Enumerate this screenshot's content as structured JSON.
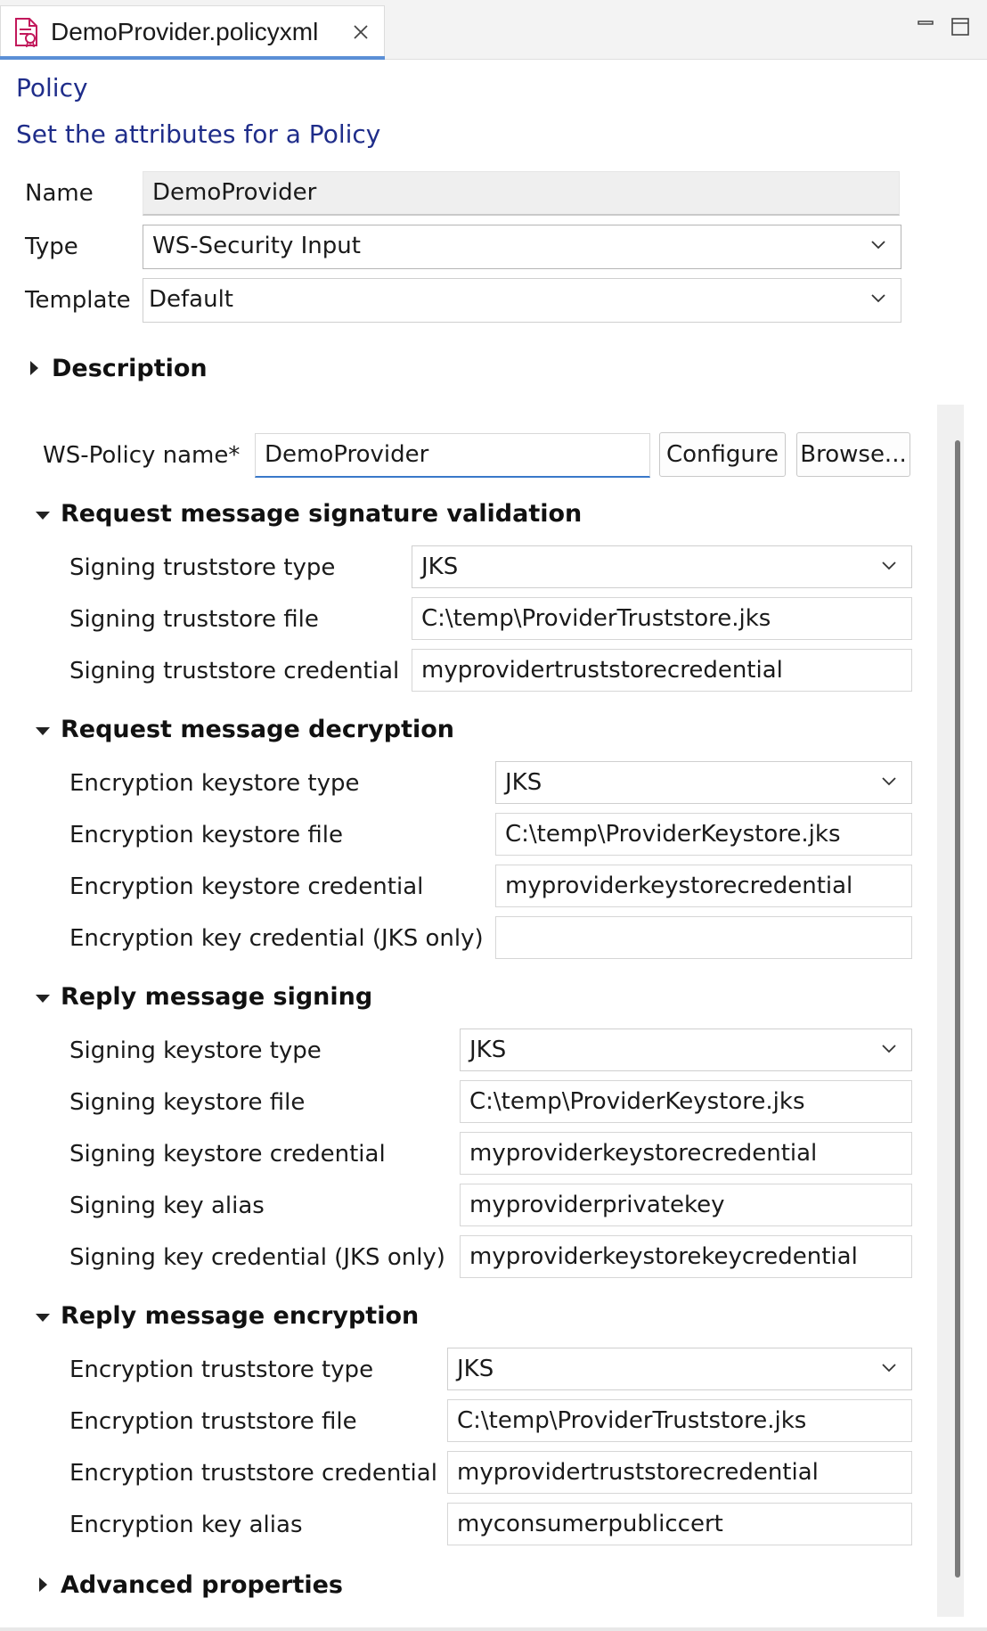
{
  "tab": {
    "title": "DemoProvider.policyxml",
    "icon": "policy-file-icon",
    "close_icon": "close-icon"
  },
  "window_controls": {
    "minimize_icon": "minimize-icon",
    "maximize_icon": "maximize-icon"
  },
  "page": {
    "title": "Policy",
    "subtitle": "Set the attributes for a Policy"
  },
  "form": {
    "name_label": "Name",
    "name_value": "DemoProvider",
    "type_label": "Type",
    "type_value": "WS-Security Input",
    "template_label": "Template",
    "template_value": "Default"
  },
  "description": {
    "label": "Description"
  },
  "ws_policy": {
    "label": "WS-Policy name*",
    "value": "DemoProvider",
    "configure_label": "Configure",
    "browse_label": "Browse..."
  },
  "request_signature": {
    "header": "Request message signature validation",
    "type_label": "Signing truststore type",
    "type_value": "JKS",
    "file_label": "Signing truststore file",
    "file_value": "C:\\temp\\ProviderTruststore.jks",
    "credential_label": "Signing truststore credential",
    "credential_value": "myprovidertruststorecredential"
  },
  "request_decryption": {
    "header": "Request message decryption",
    "type_label": "Encryption keystore type",
    "type_value": "JKS",
    "file_label": "Encryption keystore file",
    "file_value": "C:\\temp\\ProviderKeystore.jks",
    "credential_label": "Encryption keystore credential",
    "credential_value": "myproviderkeystorecredential",
    "key_credential_label": "Encryption key credential (JKS only)",
    "key_credential_value": ""
  },
  "reply_signing": {
    "header": "Reply message signing",
    "type_label": "Signing keystore type",
    "type_value": "JKS",
    "file_label": "Signing keystore file",
    "file_value": "C:\\temp\\ProviderKeystore.jks",
    "credential_label": "Signing keystore credential",
    "credential_value": "myproviderkeystorecredential",
    "alias_label": "Signing key alias",
    "alias_value": "myproviderprivatekey",
    "key_credential_label": "Signing key credential (JKS only)",
    "key_credential_value": "myproviderkeystorekeycredential"
  },
  "reply_encryption": {
    "header": "Reply message encryption",
    "type_label": "Encryption truststore type",
    "type_value": "JKS",
    "file_label": "Encryption truststore file",
    "file_value": "C:\\temp\\ProviderTruststore.jks",
    "credential_label": "Encryption truststore credential",
    "credential_value": "myprovidertruststorecredential",
    "alias_label": "Encryption key alias",
    "alias_value": "myconsumerpubliccert"
  },
  "advanced": {
    "label": "Advanced properties"
  },
  "colors": {
    "accent": "#3a78c9",
    "heading": "#1f2d8a",
    "tab_border": "#5b8fd6"
  }
}
